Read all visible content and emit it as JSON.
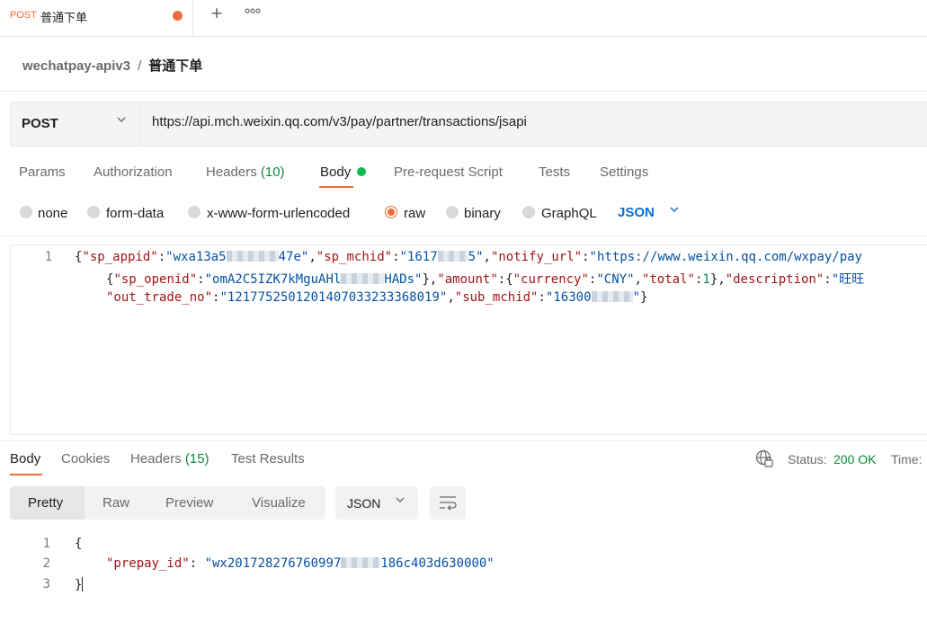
{
  "tab": {
    "method": "POST",
    "title": "普通下单"
  },
  "breadcrumb": {
    "collection": "wechatpay-apiv3",
    "separator": "/",
    "request": "普通下单"
  },
  "request": {
    "method": "POST",
    "url": "https://api.mch.weixin.qq.com/v3/pay/partner/transactions/jsapi",
    "tabs": {
      "params": "Params",
      "authorization": "Authorization",
      "headers": "Headers",
      "headers_count": "(10)",
      "body": "Body",
      "prerequest": "Pre-request Script",
      "tests": "Tests",
      "settings": "Settings"
    },
    "body_types": {
      "none": "none",
      "form_data": "form-data",
      "urlencoded": "x-www-form-urlencoded",
      "raw": "raw",
      "binary": "binary",
      "graphql": "GraphQL",
      "selected": "raw"
    },
    "format": "JSON",
    "line_number": "1",
    "body_text": {
      "l1_k1": "\"sp_appid\"",
      "l1_v1a": "\"wxa13a5",
      "l1_v1b": "47e\"",
      "l1_k2": "\"sp_mchid\"",
      "l1_v2a": "\"1617",
      "l1_v2b": "5\"",
      "l1_k3": "\"notify_url\"",
      "l1_v3": "\"https://www.weixin.qq.com/wxpay/pay",
      "l2_k1": "\"sp_openid\"",
      "l2_v1a": "\"omA2C5IZK7kMguAHl",
      "l2_v1b": "HADs\"",
      "l2_k2": "\"amount\"",
      "l2_k3": "\"currency\"",
      "l2_v3": "\"CNY\"",
      "l2_k4": "\"total\"",
      "l2_v4": "1",
      "l2_k5": "\"description\"",
      "l2_v5": "\"旺旺",
      "l3_k1": "\"out_trade_no\"",
      "l3_v1": "\"1217752501201407033233368019\"",
      "l3_k2": "\"sub_mchid\"",
      "l3_v2a": "\"16300",
      "l3_v2b": "\""
    }
  },
  "response": {
    "tabs": {
      "body": "Body",
      "cookies": "Cookies",
      "headers": "Headers",
      "headers_count": "(15)",
      "test_results": "Test Results"
    },
    "status_label": "Status:",
    "status_value": "200 OK",
    "time_label": "Time:",
    "views": {
      "pretty": "Pretty",
      "raw": "Raw",
      "preview": "Preview",
      "visualize": "Visualize"
    },
    "format": "JSON",
    "line_numbers": [
      "1",
      "2",
      "3"
    ],
    "body": {
      "open": "{",
      "key": "\"prepay_id\"",
      "value_a": "\"wx201728276760997",
      "value_b": "186c403d630000\"",
      "close": "}"
    }
  },
  "colors": {
    "accent": "#f26b3a",
    "success": "#0a8a3a",
    "link": "#0b6bd3"
  }
}
